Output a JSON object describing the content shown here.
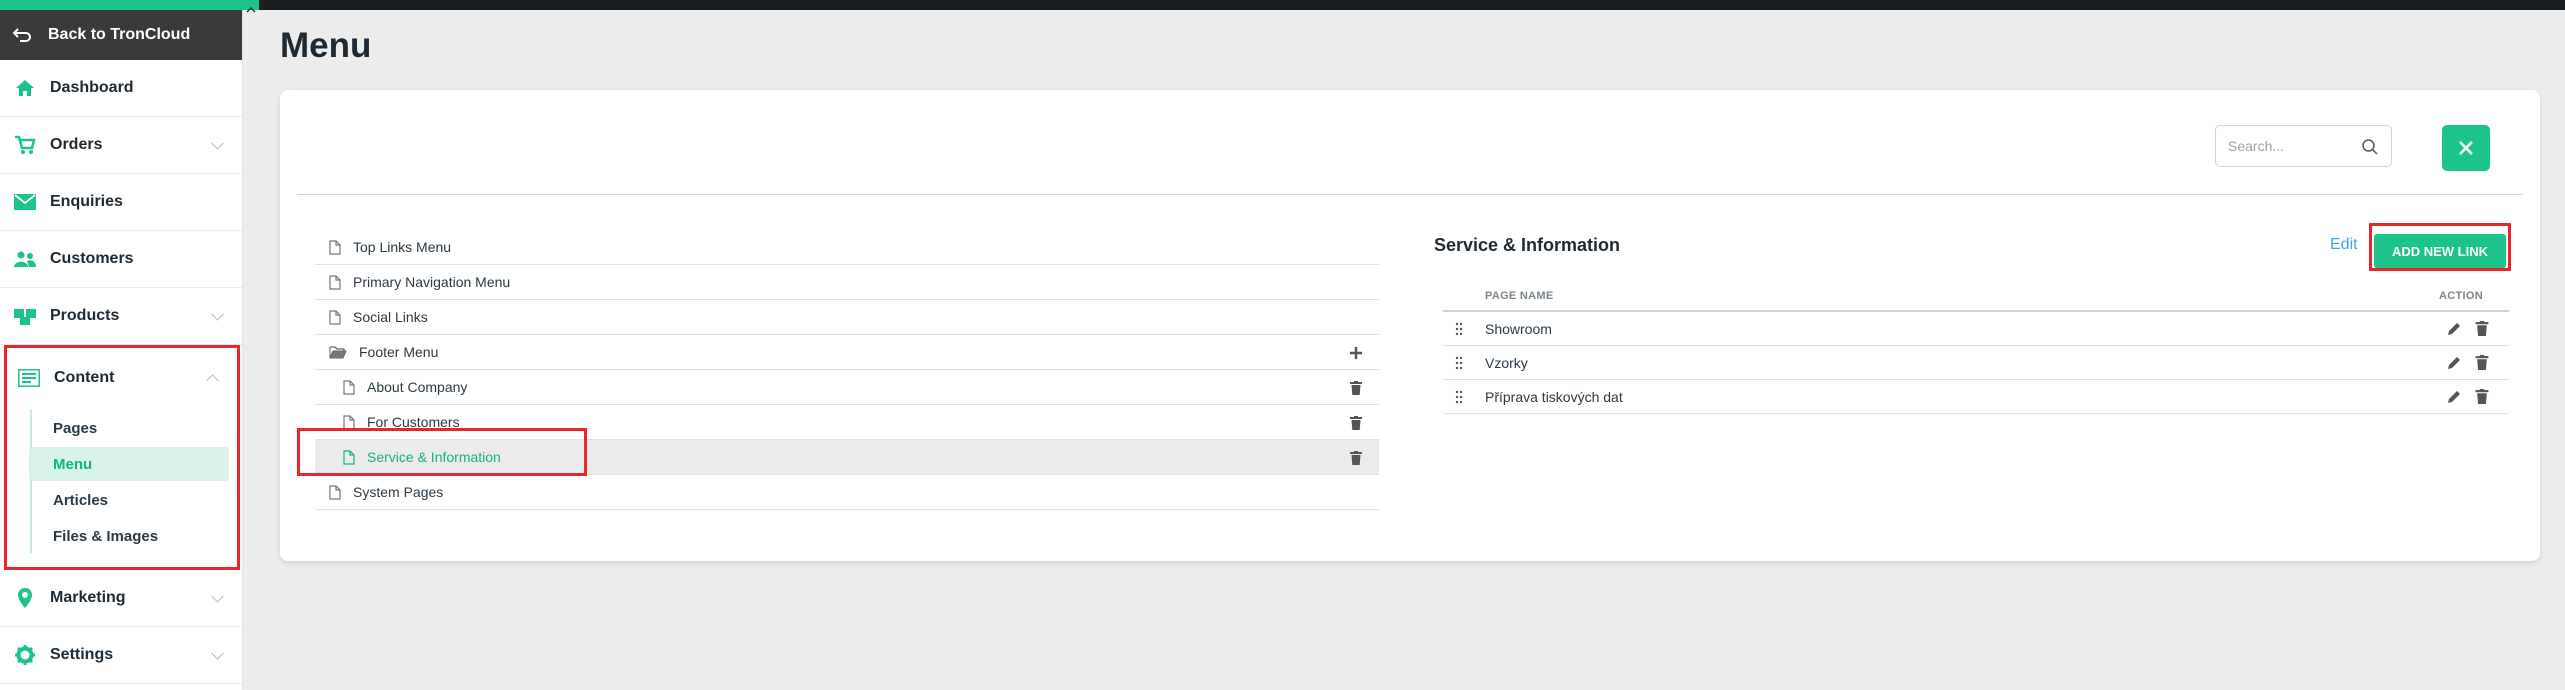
{
  "sidebar": {
    "back_label": "Back to TronCloud",
    "items": [
      {
        "label": "Dashboard",
        "icon": "home-icon",
        "has_chevron": false
      },
      {
        "label": "Orders",
        "icon": "cart-icon",
        "has_chevron": true
      },
      {
        "label": "Enquiries",
        "icon": "envelope-icon",
        "has_chevron": false
      },
      {
        "label": "Customers",
        "icon": "users-icon",
        "has_chevron": false
      },
      {
        "label": "Products",
        "icon": "boxes-icon",
        "has_chevron": true
      }
    ],
    "content": {
      "label": "Content",
      "icon": "content-icon",
      "sub_items": [
        "Pages",
        "Menu",
        "Articles",
        "Files & Images"
      ],
      "active": "Menu"
    },
    "after_items": [
      {
        "label": "Marketing",
        "icon": "pin-icon",
        "has_chevron": true
      },
      {
        "label": "Settings",
        "icon": "gear-icon",
        "has_chevron": true
      }
    ]
  },
  "page": {
    "title": "Menu"
  },
  "search": {
    "placeholder": "Search..."
  },
  "tree": [
    {
      "label": "Top Links Menu",
      "level": 0,
      "icon": "file-icon"
    },
    {
      "label": "Primary Navigation Menu",
      "level": 0,
      "icon": "file-icon"
    },
    {
      "label": "Social Links",
      "level": 0,
      "icon": "file-icon"
    },
    {
      "label": "Footer Menu",
      "level": 0,
      "icon": "folder-open-icon",
      "action": "plus-icon"
    },
    {
      "label": "About Company",
      "level": 1,
      "icon": "file-icon",
      "action": "trash-icon"
    },
    {
      "label": "For Customers",
      "level": 1,
      "icon": "file-icon",
      "action": "trash-icon"
    },
    {
      "label": "Service & Information",
      "level": 1,
      "icon": "file-icon",
      "action": "trash-icon",
      "selected": true
    },
    {
      "label": "System Pages",
      "level": 0,
      "icon": "file-icon"
    }
  ],
  "panel": {
    "title": "Service & Information",
    "edit_label": "Edit",
    "add_label": "ADD NEW LINK",
    "col_name": "PAGE NAME",
    "col_action": "ACTION",
    "rows": [
      "Showroom",
      "Vzorky",
      "Příprava tiskových dat"
    ]
  },
  "colors": {
    "accent": "#1cc48a",
    "highlight": "#e8272a",
    "link": "#3ea6dd"
  }
}
